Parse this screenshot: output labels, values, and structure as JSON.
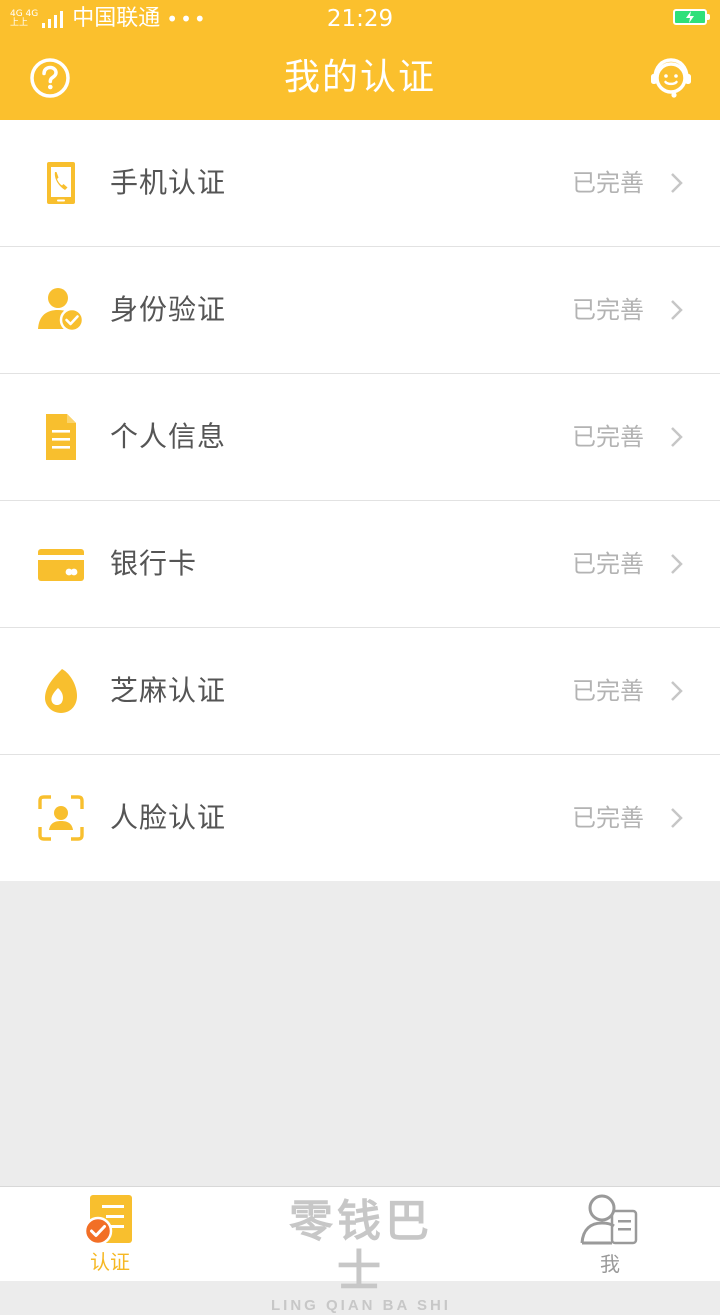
{
  "status_bar": {
    "network_top": "4G 4G",
    "network_bottom": "上上",
    "carrier": "中国联通",
    "dots": "•••",
    "time": "21:29",
    "battery_color": "#2ee07a"
  },
  "header": {
    "title": "我的认证",
    "left_icon": "help-circle-icon",
    "right_icon": "customer-service-icon",
    "bg_color": "#fbc02d"
  },
  "items": [
    {
      "label": "手机认证",
      "status": "已完善",
      "icon": "phone-icon"
    },
    {
      "label": "身份验证",
      "status": "已完善",
      "icon": "user-verified-icon"
    },
    {
      "label": "个人信息",
      "status": "已完善",
      "icon": "document-icon"
    },
    {
      "label": "银行卡",
      "status": "已完善",
      "icon": "bank-card-icon"
    },
    {
      "label": "芝麻认证",
      "status": "已完善",
      "icon": "sesame-icon"
    },
    {
      "label": "人脸认证",
      "status": "已完善",
      "icon": "face-scan-icon"
    }
  ],
  "tabbar": {
    "cert_label": "认证",
    "me_label": "我",
    "logo_cn": "零钱巴士",
    "logo_en": "LING QIAN BA SHI",
    "active_color": "#f6b824",
    "inactive_color": "#9a9a9a"
  }
}
